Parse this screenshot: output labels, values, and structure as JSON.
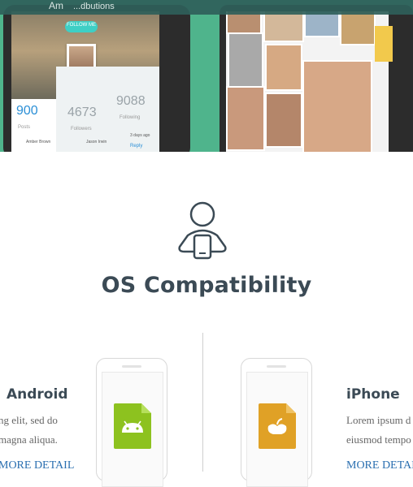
{
  "hero": {
    "topbar_title": "Am",
    "topbar_sub": "...dbutions",
    "follow_label": "FOLLOW ME",
    "stats": [
      {
        "value": "900",
        "label": "Posts",
        "color": "#2b8fd6"
      },
      {
        "value": "4673",
        "label": "Followers",
        "color": "#9aa3a8"
      },
      {
        "value": "9088",
        "label": "Following",
        "color": "#9aa3a8"
      }
    ],
    "bottom_left": "Amber Brown",
    "bottom_mid": "Jason Irwin",
    "time_ago": "3 days ago",
    "reply": "Reply"
  },
  "section": {
    "title": "OS Compatibility",
    "icon": "person-tablet-icon"
  },
  "left_column": {
    "title": "Android",
    "line1": "ng elit, sed do",
    "line2": "magna aliqua.",
    "link": "MORE DETAIL",
    "app_icon": "android-file-icon",
    "app_color": "#8dc21f"
  },
  "right_column": {
    "title": "iPhone",
    "line1": "Lorem ipsum d",
    "line2": "eiusmod tempo",
    "link": "MORE DETAIL",
    "app_icon": "apple-file-icon",
    "app_color": "#e0a126"
  },
  "colors": {
    "hero_green": "#4fb48c",
    "heading": "#3b4a55",
    "link": "#2a6fb0"
  }
}
